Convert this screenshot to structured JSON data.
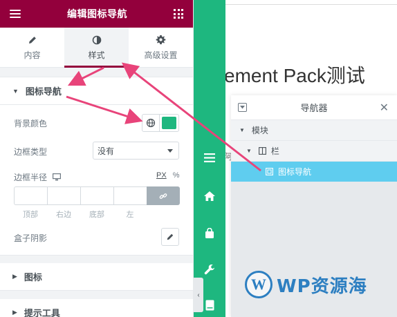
{
  "panel": {
    "title": "编辑图标导航",
    "tabs": [
      {
        "label": "内容",
        "icon": "pencil-icon"
      },
      {
        "label": "样式",
        "icon": "contrast-icon"
      },
      {
        "label": "高级设置",
        "icon": "gear-icon"
      }
    ],
    "active_tab": "样式",
    "section_title": "图标导航",
    "controls": {
      "bg_color_label": "背景颜色",
      "bg_color_value": "#1eb77f",
      "border_type_label": "边框类型",
      "border_type_value": "没有",
      "border_radius_label": "边框半径",
      "unit_px": "PX",
      "unit_pct": "%",
      "dim_labels": [
        "顶部",
        "右边",
        "底部",
        "左"
      ],
      "box_shadow_label": "盒子阴影"
    },
    "collapsed_sections": [
      "图标",
      "提示工具"
    ]
  },
  "preview": {
    "title": "ement Pack测试 ",
    "side_char": "阿"
  },
  "navigator": {
    "title": "导航器",
    "rows": [
      {
        "label": "模块",
        "indent": 0
      },
      {
        "label": "栏",
        "indent": 1
      },
      {
        "label": "图标导航",
        "indent": 2,
        "selected": true
      }
    ]
  },
  "watermark": {
    "text": "WP资源海",
    "logo_letter": "W"
  },
  "colors": {
    "brand": "#93003c",
    "accent_green": "#1eb77f",
    "arrow": "#e8447a",
    "nav_selected": "#5fcdef"
  }
}
